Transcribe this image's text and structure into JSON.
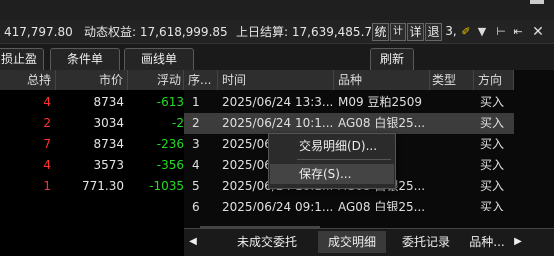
{
  "colors": {
    "up": "#ff3030",
    "down": "#22dd22",
    "selected_row": "#3c3c3c",
    "background": "#000000"
  },
  "account_bar": {
    "balance_fragment": "417,797.80",
    "dynamic_equity_label": "动态权益: 17,618,999.85",
    "prev_settlement_label": "上日结算: 17,639,485.79",
    "buttons": [
      "统",
      "计",
      "详",
      "退",
      "3,"
    ]
  },
  "toolbar": {
    "pl_label": "损止盈",
    "conditional_label": "条件单",
    "line_order_label": "画线单",
    "refresh_label": "刷新"
  },
  "positions": {
    "headers": [
      "总持",
      "市价",
      "浮动"
    ],
    "rows": [
      {
        "qty": "4",
        "price": "8734",
        "float": "-613"
      },
      {
        "qty": "2",
        "price": "3034",
        "float": "-2"
      },
      {
        "qty": "7",
        "price": "8734",
        "float": "-236"
      },
      {
        "qty": "4",
        "price": "3573",
        "float": "-356"
      },
      {
        "qty": "1",
        "price": "771.30",
        "float": "-1035"
      }
    ]
  },
  "trades": {
    "headers": [
      "序...",
      "时间",
      "品种",
      "类型",
      "方向"
    ],
    "rows": [
      {
        "seq": "1",
        "time": "2025/06/24 13:3...",
        "symbol": "M09 豆粕2509",
        "type": "",
        "dir": "买入"
      },
      {
        "seq": "2",
        "time": "2025/06/24 10:1...",
        "symbol": "AG08 白银25...",
        "type": "",
        "dir": "买入"
      },
      {
        "seq": "3",
        "time": "2025/06/2",
        "symbol": "",
        "type": "",
        "dir": "买入"
      },
      {
        "seq": "4",
        "time": "2025/06/2",
        "symbol": "",
        "type": "",
        "dir": "买入"
      },
      {
        "seq": "5",
        "time": "2025/06/24 10:1...",
        "symbol": "AG08 白银25...",
        "type": "",
        "dir": "买入"
      },
      {
        "seq": "6",
        "time": "2025/06/24 09:1...",
        "symbol": "AG08 白银25...",
        "type": "",
        "dir": "买入"
      }
    ]
  },
  "context_menu": {
    "items": [
      "交易明细(D)...",
      "保存(S)..."
    ]
  },
  "tabs": [
    "未成交委托",
    "成交明细",
    "委托记录",
    "品种..."
  ]
}
